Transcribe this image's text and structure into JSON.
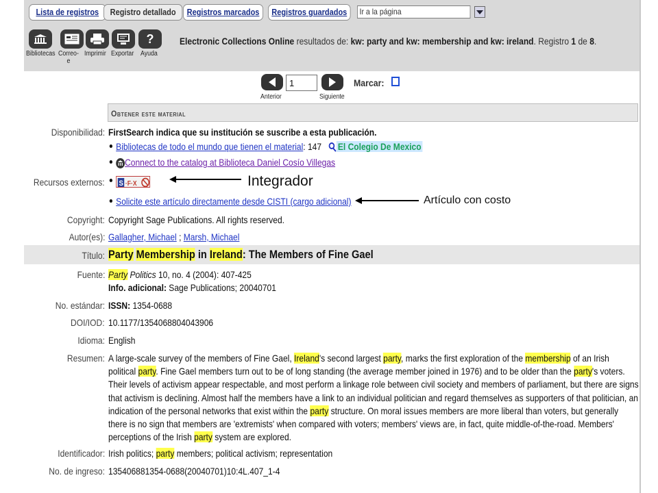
{
  "tabs": [
    {
      "label": "Lista de registros"
    },
    {
      "label": "Registro detallado"
    },
    {
      "label": "Registros marcados"
    },
    {
      "label": "Registros guardados"
    }
  ],
  "goto": {
    "value": "Ir a la página"
  },
  "toolbar": {
    "items": [
      {
        "label": "Bibliotecas",
        "icon": "library-icon"
      },
      {
        "label": "Correo-\ne",
        "icon": "email-icon"
      },
      {
        "label": "Imprimir",
        "icon": "print-icon"
      },
      {
        "label": "Exportar",
        "icon": "export-icon"
      },
      {
        "label": "Ayuda",
        "icon": "help-icon"
      }
    ],
    "summary": {
      "db": "Electronic Collections Online",
      "results_de": "resultados de:",
      "query": "kw: party and kw: membership and kw: ireland",
      "registro": ". Registro",
      "current": "1",
      "de": "de",
      "total": "8",
      "end": "."
    }
  },
  "nav": {
    "record_no": "1",
    "prev": "Anterior",
    "next": "Siguiente",
    "mark": "Marcar:"
  },
  "section": {
    "title": "Obtener este material"
  },
  "availability": {
    "label": "Disponibilidad:",
    "statement": "FirstSearch indica que su institución se suscribe a esta publicación.",
    "libraries_link": "Bibliotecas de todo el mundo que tienen el material",
    "libraries_count": ": 147",
    "holding": "El Colegio De Mexico",
    "catalog_link": "Connect to the catalog at Biblioteca Daniel Cosío Villegas"
  },
  "external": {
    "label": "Recursos externos:",
    "sfx_text": "SFX",
    "cisti_link": "Solicite este artículo directamente desde CISTI (cargo adicional)"
  },
  "copyright": {
    "label": "Copyright:",
    "value": "Copyright Sage Publications. All rights reserved."
  },
  "authors": {
    "label": "Autor(es):",
    "a1": "Gallagher, Michael",
    "sep": " ; ",
    "a2": "Marsh, Michael"
  },
  "title": {
    "label": "Título:",
    "w1": "Party",
    "w2": "Membership",
    "w3": " in ",
    "w4": "Ireland",
    "rest": ": The Members of Fine Gael"
  },
  "source": {
    "label": "Fuente:",
    "w1": "Party",
    "journal": " Politics",
    "rest": " 10, no. 4 (2004): 407-425",
    "info_label": "Info. adicional:",
    "info": " Sage Publications; 20040701"
  },
  "issn": {
    "label": "No. estándar:",
    "key": "ISSN:",
    "value": " 1354-0688"
  },
  "doi": {
    "label": "DOI/IOD:",
    "value": "10.1177/1354068804043906"
  },
  "language": {
    "label": "Idioma:",
    "value": "English"
  },
  "abstract": {
    "label": "Resumen:",
    "parts": [
      "A large-scale survey of the members of Fine Gael, ",
      "Ireland",
      "'s second largest ",
      "party",
      ", marks the first exploration of the ",
      "membership",
      " of an Irish political ",
      "party",
      ". Fine Gael members turn out to be of long standing (the average member joined in 1976) and to be older than the ",
      "party",
      "'s voters. Their levels of activism appear respectable, and most perform a linkage role between civil society and members of parliament, but there are signs that activism is declining. Almost half the members have a link to an individual politician and regard themselves as supporters of that politician, an indication of the personal networks that exist within the ",
      "party",
      " structure. On moral issues members are more liberal than voters, but generally there is no sign that members are 'extremists' when compared with voters; members' views are, in fact, quite middle-of-the-road. Members' perceptions of the Irish ",
      "party",
      " system are explored."
    ]
  },
  "identifier": {
    "label": "Identificador:",
    "a": "Irish politics; ",
    "hl": "party",
    "b": " members; political activism; representation"
  },
  "accession": {
    "label": "No. de ingreso:",
    "value": "135406881354-0688(20040701)10:4L.407_1-4"
  },
  "annotations": {
    "integrador": "Integrador",
    "articulo": "Artículo con costo"
  }
}
